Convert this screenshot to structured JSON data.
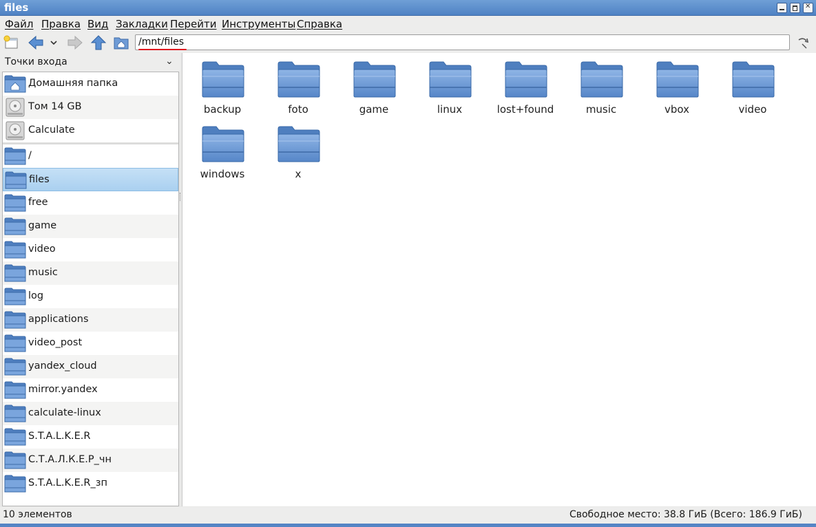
{
  "window": {
    "title": "files"
  },
  "menu": [
    "Файл",
    "Правка",
    "Вид",
    "Закладки",
    "Перейти",
    "Инструменты",
    "Справка"
  ],
  "toolbar": {
    "path": "/mnt/files"
  },
  "sidebar": {
    "header": "Точки входа",
    "places": [
      {
        "label": "Домашняя папка",
        "icon": "home-folder-icon"
      },
      {
        "label": "Том 14 GB",
        "icon": "drive-icon"
      },
      {
        "label": "Calculate",
        "icon": "drive-icon"
      }
    ],
    "bookmarks": [
      {
        "label": "/"
      },
      {
        "label": "files"
      },
      {
        "label": "free"
      },
      {
        "label": "game"
      },
      {
        "label": "video"
      },
      {
        "label": "music"
      },
      {
        "label": "log"
      },
      {
        "label": "applications"
      },
      {
        "label": "video_post"
      },
      {
        "label": "yandex_cloud"
      },
      {
        "label": "mirror.yandex"
      },
      {
        "label": "calculate-linux"
      },
      {
        "label": "S.T.A.L.K.E.R"
      },
      {
        "label": "С.Т.А.Л.К.Е.Р_чн"
      },
      {
        "label": "S.T.A.L.K.E.R_зп"
      }
    ],
    "selected": "files"
  },
  "files": [
    "backup",
    "foto",
    "game",
    "linux",
    "lost+found",
    "music",
    "vbox",
    "video",
    "windows",
    "x"
  ],
  "status": {
    "count": "10 элементов",
    "free_space": "Свободное место: 38.8 ГиБ (Всего: 186.9 ГиБ)"
  },
  "colors": {
    "titlebar": "#5b8ccb",
    "selection": "#b6d7f3",
    "folder": "#6e9bd6",
    "path_underline": "#e0191f"
  }
}
